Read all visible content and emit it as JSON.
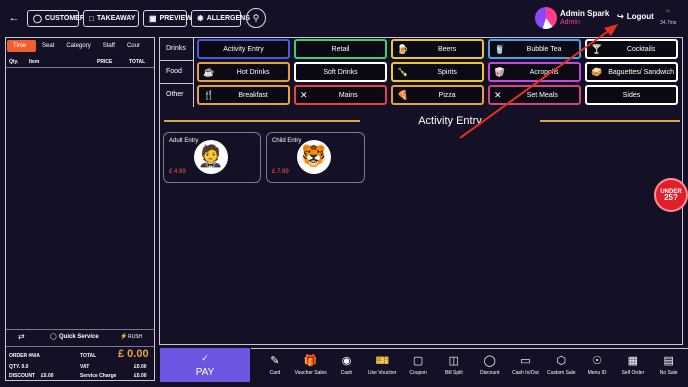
{
  "topbar": {
    "customer": "CUSTOMER",
    "takeaway": "TAKEAWAY",
    "preview": "PREVIEW",
    "allergens": "ALLERGENS",
    "user_name": "Admin Spark",
    "user_role": "Admin",
    "logout": "Logout",
    "ping": "34.7ms"
  },
  "order": {
    "tabs": [
      "Time",
      "Seat",
      "Category",
      "Staff",
      "Cour"
    ],
    "cols": {
      "qty": "Qty.",
      "item": "Item",
      "price": "PRICE",
      "total": "TOTAL"
    },
    "quick_service": "Quick Service",
    "rush": "RUSH",
    "footer": {
      "order_no_label": "ORDER #N/A",
      "total_label": "TOTAL",
      "total_value": "£ 0.00",
      "qty_label": "QTY. 0.0",
      "vat_label": "VAT",
      "vat_value": "£0.00",
      "discount_label": "DISCOUNT",
      "discount_value": "£0.00",
      "service_label": "Service Charge",
      "service_value": "£0.00"
    }
  },
  "categories": {
    "rows": [
      "Drinks",
      "Food",
      "Other"
    ],
    "items": [
      {
        "label": "Activity Entry",
        "icon": "",
        "color": "#4a5bd6"
      },
      {
        "label": "Retail",
        "icon": "",
        "color": "#3ecf6e"
      },
      {
        "label": "Beers",
        "icon": "beer-icon",
        "color": "#e8c838"
      },
      {
        "label": "Bubble Tea",
        "icon": "bubble-tea-icon",
        "color": "#4aa5e8"
      },
      {
        "label": "Cocktails",
        "icon": "cocktail-icon",
        "color": "#ffffff"
      },
      {
        "label": "Hot Drinks",
        "icon": "coffee-icon",
        "color": "#e0a040"
      },
      {
        "label": "Soft Drinks",
        "icon": "",
        "color": "#ffffff"
      },
      {
        "label": "Spirits",
        "icon": "bottle-icon",
        "color": "#e8c838"
      },
      {
        "label": "Acropolis",
        "icon": "takeaway-icon",
        "color": "#c24bd6"
      },
      {
        "label": "Baguettes/ Sandwich",
        "icon": "sandwich-icon",
        "color": "#ffffff"
      },
      {
        "label": "Breakfast",
        "icon": "cutlery-icon",
        "color": "#e8a338"
      },
      {
        "label": "Mains",
        "icon": "utensils-icon",
        "color": "#e04545"
      },
      {
        "label": "Pizza",
        "icon": "pizza-icon",
        "color": "#e8a338"
      },
      {
        "label": "Set Meals",
        "icon": "set-meal-icon",
        "color": "#d4457a"
      },
      {
        "label": "Sides",
        "icon": "",
        "color": "#ffffff"
      }
    ]
  },
  "section_title": "Activity Entry",
  "products": [
    {
      "name": "Adult Entry",
      "price": "£ 4.99",
      "icon": "person-icon"
    },
    {
      "name": "Child Entry",
      "price": "£ 7.99",
      "icon": "tiger-icon"
    }
  ],
  "badge": {
    "line1": "UNDER",
    "line2": "25?"
  },
  "pay": "PAY",
  "actions": [
    "Card",
    "Voucher Sales",
    "Cash",
    "Use Voucher",
    "Coupon",
    "Bill Split",
    "Discount",
    "Cash In/Out",
    "Custom Sale",
    "Menu ID",
    "Self Order",
    "No Sale"
  ]
}
